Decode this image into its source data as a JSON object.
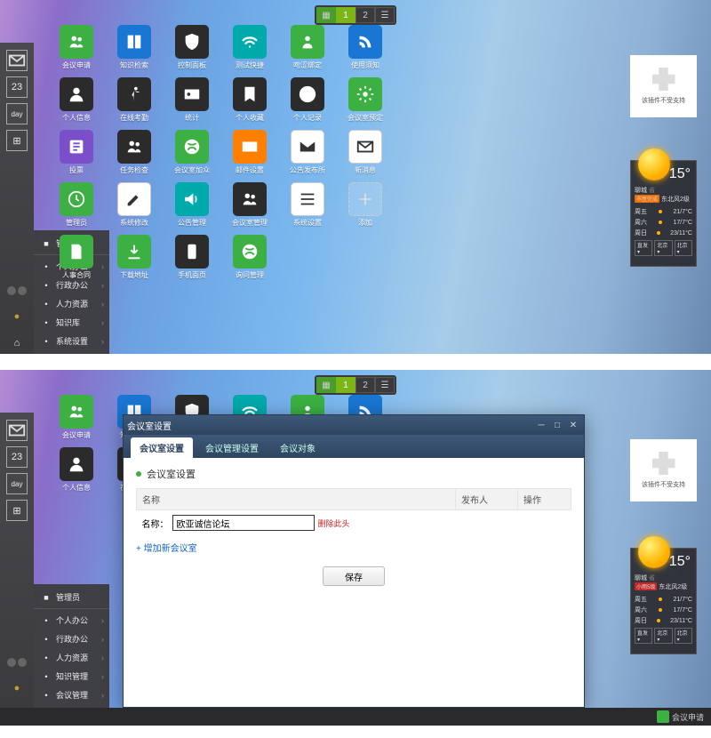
{
  "pager": {
    "pages": [
      "1",
      "2"
    ],
    "active": 0
  },
  "apps_top": [
    {
      "label": "会议申请",
      "color": "c-green",
      "icon": "people"
    },
    {
      "label": "知识检索",
      "color": "c-blue",
      "icon": "book"
    },
    {
      "label": "控制面板",
      "color": "c-dark",
      "icon": "shield"
    },
    {
      "label": "测试快捷",
      "color": "c-teal",
      "icon": "wifi"
    },
    {
      "label": "吻涩绑定",
      "color": "c-green",
      "icon": "group"
    },
    {
      "label": "使用须知",
      "color": "c-blue",
      "icon": "rss"
    },
    {
      "label": "个人信息",
      "color": "c-dark",
      "icon": "user"
    },
    {
      "label": "在线考勤",
      "color": "c-dark",
      "icon": "run"
    },
    {
      "label": "统计",
      "color": "c-dark",
      "icon": "card"
    },
    {
      "label": "个人收藏",
      "color": "c-dark",
      "icon": "bookmark"
    },
    {
      "label": "个人记录",
      "color": "c-dark",
      "icon": "chart"
    },
    {
      "label": "会议室预定",
      "color": "c-green",
      "icon": "gear"
    },
    {
      "label": "投票",
      "color": "c-purple",
      "icon": "vote"
    },
    {
      "label": "任务检查",
      "color": "c-dark",
      "icon": "people"
    },
    {
      "label": "会议室加众",
      "color": "c-green",
      "icon": "xbox"
    },
    {
      "label": "邮件设置",
      "color": "c-orange",
      "icon": "mail"
    },
    {
      "label": "公告发布所",
      "color": "c-white",
      "icon": "mail"
    },
    {
      "label": "新消息",
      "color": "c-white",
      "icon": "mail2"
    },
    {
      "label": "管理员",
      "color": "c-green",
      "icon": "clock"
    },
    {
      "label": "系统修改",
      "color": "c-white",
      "icon": "edit"
    },
    {
      "label": "公告管理",
      "color": "c-teal",
      "icon": "speaker"
    },
    {
      "label": "会议室管理",
      "color": "c-dark",
      "icon": "people"
    },
    {
      "label": "系统设置",
      "color": "c-white",
      "icon": "lines"
    },
    {
      "label": "添加",
      "color": "c-add",
      "icon": "plus"
    },
    {
      "label": "人事合同",
      "color": "c-green",
      "icon": "doc"
    },
    {
      "label": "下载地址",
      "color": "c-green",
      "icon": "down"
    },
    {
      "label": "手机面页",
      "color": "c-dark",
      "icon": "phone"
    },
    {
      "label": "询问管理",
      "color": "c-green",
      "icon": "xbox"
    }
  ],
  "start_menu": [
    {
      "label": "管理员",
      "icon": "sq",
      "noarrow": true
    },
    {
      "label": "个人办公",
      "icon": "user"
    },
    {
      "label": "行政办公",
      "icon": "group"
    },
    {
      "label": "人力资源",
      "icon": "person"
    },
    {
      "label": "知识库",
      "icon": "book"
    },
    {
      "label": "系统设置",
      "icon": "wrench"
    }
  ],
  "start_menu2": [
    {
      "label": "管理员",
      "icon": "sq",
      "noarrow": true
    },
    {
      "label": "个人办公",
      "icon": "user"
    },
    {
      "label": "行政办公",
      "icon": "group"
    },
    {
      "label": "人力资源",
      "icon": "person"
    },
    {
      "label": "知识管理",
      "icon": "book"
    },
    {
      "label": "会议管理",
      "icon": "wrench"
    }
  ],
  "plugin_text": "该插件不受支持",
  "weather": {
    "city": "聊城",
    "city_suffix": "省",
    "temp": "15°",
    "badge1_a": "市医完成",
    "badge1_b": "东北风2级",
    "badge2_a": "小雨5级",
    "badge2_b": "东北风2级",
    "forecast": [
      {
        "day": "周五",
        "range": "21/7°C"
      },
      {
        "day": "周六",
        "range": "17/7°C"
      },
      {
        "day": "周日",
        "range": "23/11°C"
      }
    ],
    "selectors": [
      "直发",
      "北京",
      "北京"
    ]
  },
  "modal": {
    "title": "会议室设置",
    "tabs": [
      "会议室设置",
      "会议管理设置",
      "会议对象"
    ],
    "active_tab": 0,
    "section_title": "会议室设置",
    "columns": [
      "名称",
      "发布人",
      "操作"
    ],
    "row_label": "名称：",
    "row_value": "欧亚诚信论坛",
    "row_action": "删除此头",
    "add_link": "+ 增加新会议室",
    "save_btn": "保存"
  },
  "footer_label": "会议申请",
  "vbar": {
    "mail": "mail",
    "cal_num": "23",
    "day": "day"
  }
}
